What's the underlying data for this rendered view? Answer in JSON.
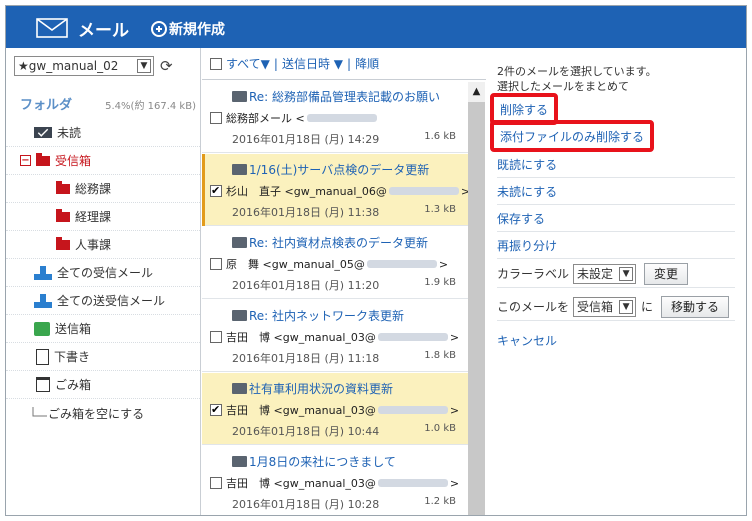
{
  "header": {
    "app_title": "メール",
    "compose_label": "新規作成"
  },
  "sidebar": {
    "account": "★gw_manual_02",
    "folder_header": "フォルダ",
    "quota": "5.4%(約 167.4 kB)",
    "folders": [
      {
        "label": "未読"
      },
      {
        "label": "受信箱"
      },
      {
        "label": "総務課"
      },
      {
        "label": "経理課"
      },
      {
        "label": "人事課"
      },
      {
        "label": "全ての受信メール"
      },
      {
        "label": "全ての送受信メール"
      },
      {
        "label": "送信箱"
      },
      {
        "label": "下書き"
      },
      {
        "label": "ごみ箱"
      },
      {
        "label": "ごみ箱を空にする"
      }
    ]
  },
  "list": {
    "sort_all": "すべて▼",
    "sort_sep1": "|",
    "sort_date": "送信日時 ▼",
    "sort_sep2": "|",
    "sort_order": "降順",
    "messages": [
      {
        "subject": "Re: 総務部備品管理表記載のお願い",
        "from": "総務部メール <",
        "from_end": "",
        "date": "2016年01月18日 (月) 14:29",
        "size": "1.6 kB",
        "checked": false,
        "selected": false
      },
      {
        "subject": "1/16(土)サーバ点検のデータ更新",
        "from": "杉山　直子 <gw_manual_06@",
        "from_end": ">",
        "date": "2016年01月18日 (月) 11:38",
        "size": "1.3 kB",
        "checked": true,
        "selected": true
      },
      {
        "subject": "Re: 社内資材点検表のデータ更新",
        "from": "原　舞 <gw_manual_05@",
        "from_end": ">",
        "date": "2016年01月18日 (月) 11:20",
        "size": "1.9 kB",
        "checked": false,
        "selected": false
      },
      {
        "subject": "Re: 社内ネットワーク表更新",
        "from": "吉田　博 <gw_manual_03@",
        "from_end": ">",
        "date": "2016年01月18日 (月) 11:18",
        "size": "1.8 kB",
        "checked": false,
        "selected": false
      },
      {
        "subject": "社有車利用状況の資料更新",
        "from": "吉田　博 <gw_manual_03@",
        "from_end": ">",
        "date": "2016年01月18日 (月) 10:44",
        "size": "1.0 kB",
        "checked": true,
        "selected": true
      },
      {
        "subject": "1月8日の来社につきまして",
        "from": "吉田　博 <gw_manual_03@",
        "from_end": ">",
        "date": "2016年01月18日 (月) 10:28",
        "size": "1.2 kB",
        "checked": false,
        "selected": false
      }
    ]
  },
  "actions": {
    "status_line1": "2件のメールを選択しています。",
    "status_line2": "選択したメールをまとめて",
    "delete": "削除する",
    "delete_attachments": "添付ファイルのみ削除する",
    "mark_read": "既読にする",
    "mark_unread": "未読にする",
    "save": "保存する",
    "redistribute": "再振り分け",
    "color_label": "カラーラベル",
    "color_value": "未設定",
    "change_button": "変更",
    "move_prefix": "このメールを",
    "move_target": "受信箱",
    "move_to": "に",
    "move_button": "移動する",
    "cancel": "キャンセル"
  },
  "colors": {
    "header_bg": "#1e62b4",
    "highlight_border": "#e8121b",
    "selected_row": "#fbf1be",
    "link": "#1e62b4"
  }
}
